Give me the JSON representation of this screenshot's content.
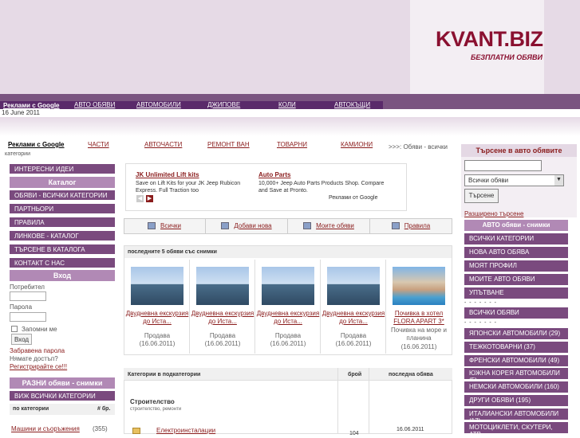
{
  "header": {
    "logo": "KVANT.BIZ",
    "tagline": "БЕЗПЛАТНИ ОБЯВИ",
    "ads_label": "Реклами с Google",
    "top_links": [
      "АВТО ОБЯВИ",
      "АВТОМОБИЛИ",
      "ДЖИПОВЕ",
      "КОЛИ",
      "АВТОКЪЩИ"
    ],
    "date": "16 June 2011"
  },
  "nav2": {
    "ads_label": "Реклами с Google",
    "links": [
      "ЧАСТИ",
      "АВТОЧАСТИ",
      "РЕМОНТ ВАН",
      "ТОВАРНИ",
      "КАМИОНИ"
    ],
    "crumb": ">>>: Обяви - всички",
    "crumb_sub": "категории"
  },
  "left": {
    "interesting": "ИНТЕРЕСНИ ИДЕИ",
    "catalog_head": "Каталог",
    "menu": [
      "ОБЯВИ - ВСИЧКИ КАТЕГОРИИ",
      "ПАРТНЬОРИ",
      "ПРАВИЛА",
      "ЛИНКОВЕ - КАТАЛОГ",
      "ТЪРСЕНЕ В КАТАЛОГА",
      "КОНТАКТ С НАС"
    ],
    "login_head": "Вход",
    "user_label": "Потребител",
    "pass_label": "Парола",
    "remember": "Запомни ме",
    "login_btn": "Вход",
    "forgot": "Забравена парола",
    "no_access": "Нямате достъп?",
    "register": "Регистрирайте се!!!",
    "various_head": "РАЗНИ обяви - снимки",
    "all_cats": "ВИЖ ВСИЧКИ КАТЕГОРИИ",
    "by_cat": "по категории",
    "count_label": "# бр.",
    "row_name": "Машини и съоръжения",
    "row_count": "(355)"
  },
  "ads": [
    {
      "title": "JK Unlimited Lift kits",
      "text": "Save on Lift Kits for your JK Jeep Rubicon Express. Full Traction too"
    },
    {
      "title": "Auto Parts",
      "text": "10,000+ Jeep Auto Parts Products Shop. Compare and Save at Pronto."
    }
  ],
  "ads_footer": "Реклами от Google",
  "tabs": [
    "Всички",
    "Добави нова",
    "Моите обяви",
    "Правила"
  ],
  "latest": {
    "title": "последните 5 обяви със снимки",
    "cards": [
      {
        "title": "Двудневна екскурзия до Иста...",
        "sub": "Продава",
        "date": "(16.06.2011)"
      },
      {
        "title": "Двудневна екскурзия до Иста...",
        "sub": "Продава",
        "date": "(16.06.2011)"
      },
      {
        "title": "Двудневна екскурзия до Иста...",
        "sub": "Продава",
        "date": "(16.06.2011)"
      },
      {
        "title": "Двудневна екскурзия до Иста...",
        "sub": "Продава",
        "date": "(16.06.2011)"
      },
      {
        "title": "Почивка в хотел FLORA APART 3*",
        "sub": "Почивка на море и планина",
        "date": "(16.06.2011)"
      }
    ]
  },
  "cat_table": {
    "col1": "Категории в подкатегории",
    "col2": "брой",
    "col3": "последна обява",
    "group": "Строителство",
    "group_sub": "строителство, ремонти",
    "row_name": "Електроинсталации",
    "row_date": "16.06.2011",
    "row_count": "104"
  },
  "right": {
    "search_title": "Търсене в авто обявите",
    "select_value": "Всички обяви",
    "search_btn": "Търсене",
    "advanced": "Разширено търсене",
    "photos_head": "АВТО обяви - снимки",
    "menu1": [
      "ВСИЧКИ КАТЕГОРИИ",
      "НОВА АВТО ОБЯВА",
      "МОЯТ ПРОФИЛ",
      "МОИТЕ АВТО ОБЯВИ",
      "УПЪТВАНЕ"
    ],
    "dots": "- - - - - - -",
    "all_ads": "ВСИЧКИ ОБЯВИ",
    "menu2": [
      "ЯПОНСКИ АВТОМОБИЛИ (29)",
      "ТЕЖКОТОВАРНИ (37)",
      "ФРЕНСКИ АВТОМОБИЛИ (49)",
      "ЮЖНА КОРЕЯ АВТОМОБИЛИ (5)",
      "НЕМСКИ АВТОМОБИЛИ (160)",
      "ДРУГИ ОБЯВИ (195)",
      "ИТАЛИАНСКИ АВТОМОБИЛИ (17)",
      "МОТОЦИКЛЕТИ, СКУТЕРИ, АТВ"
    ]
  }
}
